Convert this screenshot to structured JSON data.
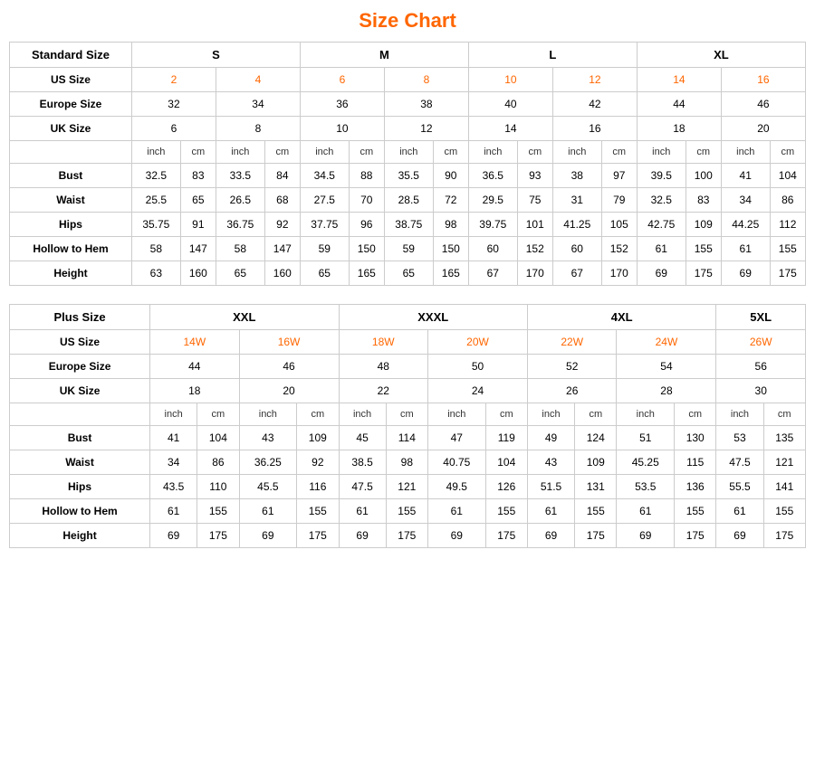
{
  "title": "Size Chart",
  "standard_table": {
    "title": "Standard Size",
    "size_groups": [
      "S",
      "M",
      "L",
      "XL"
    ],
    "size_group_spans": [
      2,
      2,
      2,
      2
    ],
    "us_sizes": [
      "2",
      "4",
      "6",
      "8",
      "10",
      "12",
      "14",
      "16"
    ],
    "europe_sizes": [
      "32",
      "34",
      "36",
      "38",
      "40",
      "42",
      "44",
      "46"
    ],
    "uk_sizes": [
      "6",
      "8",
      "10",
      "12",
      "14",
      "16",
      "18",
      "20"
    ],
    "unit_headers": [
      "inch",
      "cm",
      "inch",
      "cm",
      "inch",
      "cm",
      "inch",
      "cm",
      "inch",
      "cm",
      "inch",
      "cm",
      "inch",
      "cm",
      "inch",
      "cm"
    ],
    "measurements": {
      "Bust": [
        "32.5",
        "83",
        "33.5",
        "84",
        "34.5",
        "88",
        "35.5",
        "90",
        "36.5",
        "93",
        "38",
        "97",
        "39.5",
        "100",
        "41",
        "104"
      ],
      "Waist": [
        "25.5",
        "65",
        "26.5",
        "68",
        "27.5",
        "70",
        "28.5",
        "72",
        "29.5",
        "75",
        "31",
        "79",
        "32.5",
        "83",
        "34",
        "86"
      ],
      "Hips": [
        "35.75",
        "91",
        "36.75",
        "92",
        "37.75",
        "96",
        "38.75",
        "98",
        "39.75",
        "101",
        "41.25",
        "105",
        "42.75",
        "109",
        "44.25",
        "112"
      ],
      "Hollow to Hem": [
        "58",
        "147",
        "58",
        "147",
        "59",
        "150",
        "59",
        "150",
        "60",
        "152",
        "60",
        "152",
        "61",
        "155",
        "61",
        "155"
      ],
      "Height": [
        "63",
        "160",
        "65",
        "160",
        "65",
        "165",
        "65",
        "165",
        "67",
        "170",
        "67",
        "170",
        "69",
        "175",
        "69",
        "175"
      ]
    }
  },
  "plus_table": {
    "title": "Plus Size",
    "size_groups": [
      "XXL",
      "XXXL",
      "4XL",
      "5XL"
    ],
    "size_group_spans": [
      2,
      2,
      2,
      1
    ],
    "us_sizes": [
      "14W",
      "16W",
      "18W",
      "20W",
      "22W",
      "24W",
      "26W"
    ],
    "europe_sizes": [
      "44",
      "46",
      "48",
      "50",
      "52",
      "54",
      "56"
    ],
    "uk_sizes": [
      "18",
      "20",
      "22",
      "24",
      "26",
      "28",
      "30"
    ],
    "unit_headers": [
      "inch",
      "cm",
      "inch",
      "cm",
      "inch",
      "cm",
      "inch",
      "cm",
      "inch",
      "cm",
      "inch",
      "cm",
      "inch",
      "cm"
    ],
    "measurements": {
      "Bust": [
        "41",
        "104",
        "43",
        "109",
        "45",
        "114",
        "47",
        "119",
        "49",
        "124",
        "51",
        "130",
        "53",
        "135"
      ],
      "Waist": [
        "34",
        "86",
        "36.25",
        "92",
        "38.5",
        "98",
        "40.75",
        "104",
        "43",
        "109",
        "45.25",
        "115",
        "47.5",
        "121"
      ],
      "Hips": [
        "43.5",
        "110",
        "45.5",
        "116",
        "47.5",
        "121",
        "49.5",
        "126",
        "51.5",
        "131",
        "53.5",
        "136",
        "55.5",
        "141"
      ],
      "Hollow to Hem": [
        "61",
        "155",
        "61",
        "155",
        "61",
        "155",
        "61",
        "155",
        "61",
        "155",
        "61",
        "155",
        "61",
        "155"
      ],
      "Height": [
        "69",
        "175",
        "69",
        "175",
        "69",
        "175",
        "69",
        "175",
        "69",
        "175",
        "69",
        "175",
        "69",
        "175"
      ]
    }
  }
}
